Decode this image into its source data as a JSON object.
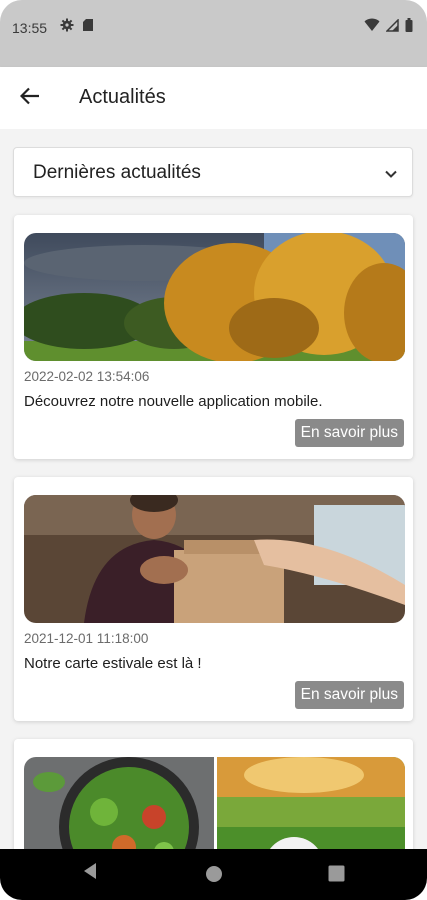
{
  "status_bar": {
    "time": "13:55",
    "icons": [
      "gear-icon",
      "sd-card-icon",
      "wifi-icon",
      "signal-icon",
      "battery-icon"
    ]
  },
  "app_bar": {
    "title": "Actualités",
    "back_icon": "arrow-left-icon"
  },
  "filter": {
    "selected": "Dernières actualités",
    "icon": "chevron-down-icon"
  },
  "news": [
    {
      "date": "2022-02-02 13:54:06",
      "text": "Découvrez notre nouvelle application mobile.",
      "button": "En savoir plus",
      "image": "autumn-trees-photo"
    },
    {
      "date": "2021-12-01 11:18:00",
      "text": "Notre carte estivale est là !",
      "button": "En savoir plus",
      "image": "takeaway-bag-photo"
    },
    {
      "image": "salad-and-golf-photo"
    }
  ],
  "nav_bar": {
    "icons": [
      "back-triangle-icon",
      "home-circle-icon",
      "recents-square-icon"
    ]
  },
  "colors": {
    "status_bar_bg": "#c9c9c9",
    "button_bg": "#8a8a8a",
    "content_bg": "#f3f3f3"
  }
}
